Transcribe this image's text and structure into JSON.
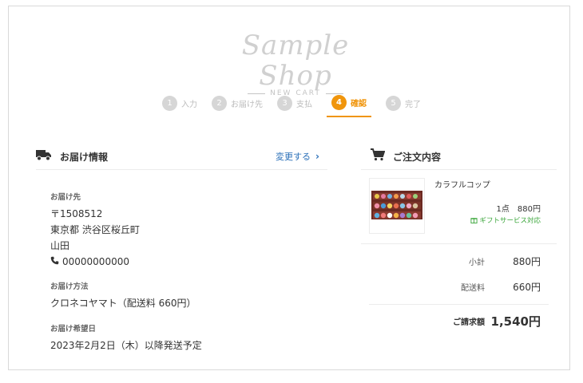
{
  "logo": {
    "title": "Sample Shop",
    "subtitle": "NEW CART"
  },
  "steps": [
    {
      "num": "1",
      "label": "入力"
    },
    {
      "num": "2",
      "label": "お届け先"
    },
    {
      "num": "3",
      "label": "支払"
    },
    {
      "num": "4",
      "label": "確認"
    },
    {
      "num": "5",
      "label": "完了"
    }
  ],
  "delivery": {
    "section_title": "お届け情報",
    "change_label": "変更する",
    "address_label": "お届け先",
    "postal": "〒1508512",
    "address": "東京都 渋谷区桜丘町",
    "name": "山田",
    "phone": "00000000000",
    "method_label": "お届け方法",
    "method": "クロネコヤマト（配送料 660円）",
    "date_label": "お届け希望日",
    "date": "2023年2月2日（木）以降発送予定"
  },
  "order": {
    "section_title": "ご注文内容",
    "item_name": "カラフルコップ",
    "item_qty_price": "1点　880円",
    "gift_note": "ギフトサービス対応",
    "subtotal_label": "小計",
    "subtotal": "880円",
    "shipping_label": "配送料",
    "shipping": "660円",
    "total_label": "ご請求額",
    "total": "1,540円"
  },
  "colors": {
    "accent": "#f0950c",
    "link": "#2a6fb8",
    "gift": "#3aa63a"
  }
}
